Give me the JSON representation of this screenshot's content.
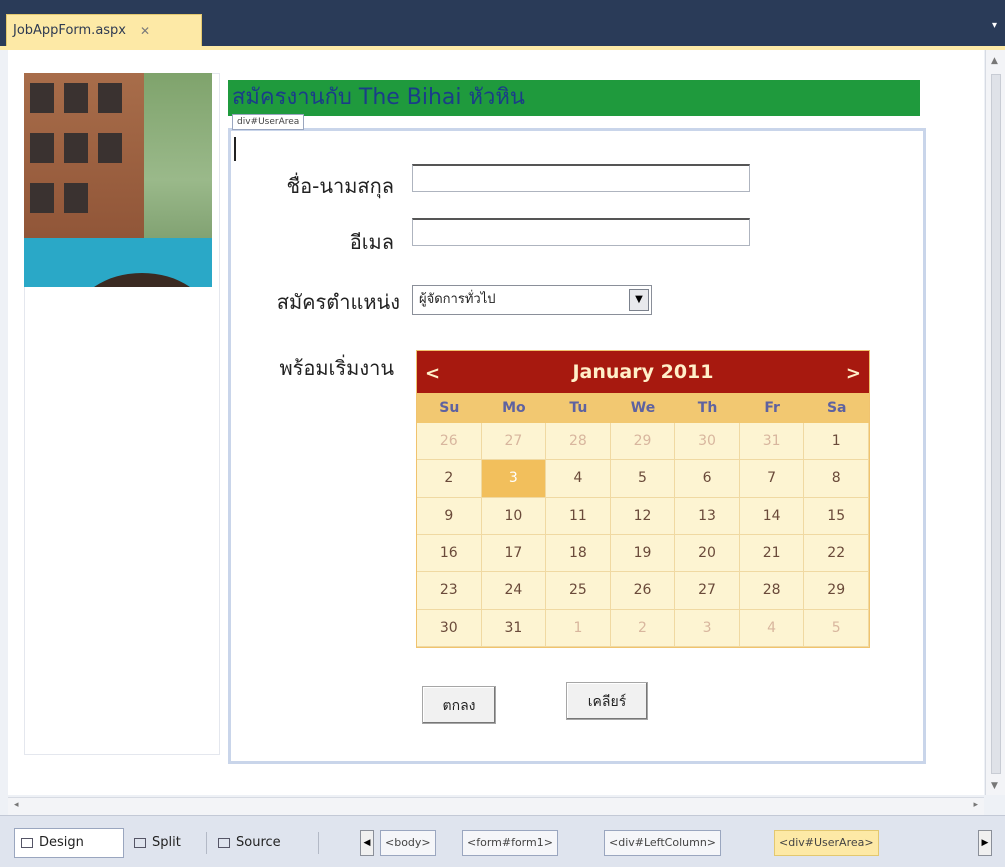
{
  "tab": {
    "title": "JobAppForm.aspx",
    "close": "✕"
  },
  "header": {
    "title": "สมัครงานกับ The Bihai หัวหิน"
  },
  "user_area_label": "div#UserArea",
  "form": {
    "name_label": "ชื่อ-นามสกุล",
    "email_label": "อีเมล",
    "position_label": "สมัครตำแหน่ง",
    "position_value": "ผู้จัดการทั่วไป",
    "start_label": "พร้อมเริ่มงาน"
  },
  "calendar": {
    "title": "January 2011",
    "prev": "<",
    "next": ">",
    "days": [
      "Su",
      "Mo",
      "Tu",
      "We",
      "Th",
      "Fr",
      "Sa"
    ],
    "weeks": [
      [
        "26",
        "27",
        "28",
        "29",
        "30",
        "31",
        "1"
      ],
      [
        "2",
        "3",
        "4",
        "5",
        "6",
        "7",
        "8"
      ],
      [
        "9",
        "10",
        "11",
        "12",
        "13",
        "14",
        "15"
      ],
      [
        "16",
        "17",
        "18",
        "19",
        "20",
        "21",
        "22"
      ],
      [
        "23",
        "24",
        "25",
        "26",
        "27",
        "28",
        "29"
      ],
      [
        "30",
        "31",
        "1",
        "2",
        "3",
        "4",
        "5"
      ]
    ],
    "selected": "3"
  },
  "buttons": {
    "ok": "ตกลง",
    "clear": "เคลียร์"
  },
  "views": {
    "design": "Design",
    "split": "Split",
    "source": "Source"
  },
  "breadcrumbs": [
    "<body>",
    "<form#form1>",
    "<div#LeftColumn>",
    "<div#UserArea>"
  ],
  "colors": {
    "header_green": "#1f9a3d",
    "calendar_header": "#a7190f",
    "calendar_dow": "#f2c871",
    "selected_day": "#f2bf5c"
  }
}
